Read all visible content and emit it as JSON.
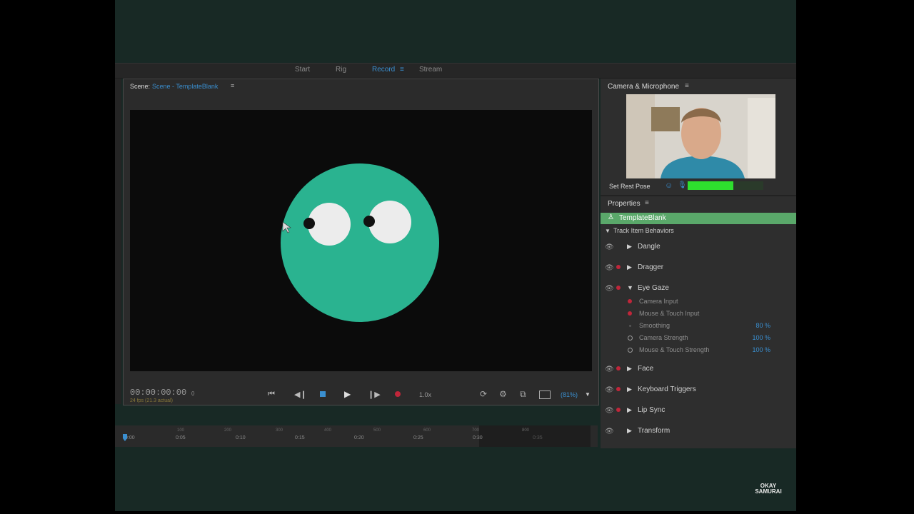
{
  "workspace_tabs": [
    "Start",
    "Rig",
    "Record",
    "Stream"
  ],
  "active_tab": "Record",
  "scene": {
    "label": "Scene:",
    "name": "Scene - TemplateBlank",
    "timecode": "00:00:00:00",
    "frame": "0",
    "fps": "24 fps (21.3 actual)",
    "speed": "1.0x",
    "zoom": "(81%)"
  },
  "camera": {
    "title": "Camera & Microphone",
    "rest_pose": "Set Rest Pose",
    "mic_level": 0.6
  },
  "properties": {
    "title": "Properties",
    "puppet": "TemplateBlank",
    "section": "Track Item Behaviors",
    "behaviors": [
      "Dangle",
      "Dragger",
      "Eye Gaze",
      "Face",
      "Keyboard Triggers",
      "Lip Sync",
      "Transform"
    ],
    "eye_gaze_params": [
      {
        "label": "Camera Input",
        "value": ""
      },
      {
        "label": "Mouse & Touch Input",
        "value": ""
      },
      {
        "label": "Smoothing",
        "value": "80 %"
      },
      {
        "label": "Camera Strength",
        "value": "100 %"
      },
      {
        "label": "Mouse & Touch Strength",
        "value": "100 %"
      }
    ]
  },
  "timeline": {
    "ticks": [
      "0:00",
      "0:05",
      "0:10",
      "0:15",
      "0:20",
      "0:25",
      "0:30",
      "0:35"
    ],
    "frames": [
      "100",
      "200",
      "300",
      "400",
      "500",
      "600",
      "700",
      "800"
    ]
  },
  "watermark": "OKAY SAMURAI",
  "colors": {
    "accent": "#3a8fd0",
    "puppet": "#2ab390",
    "selected": "#5aa86a"
  }
}
